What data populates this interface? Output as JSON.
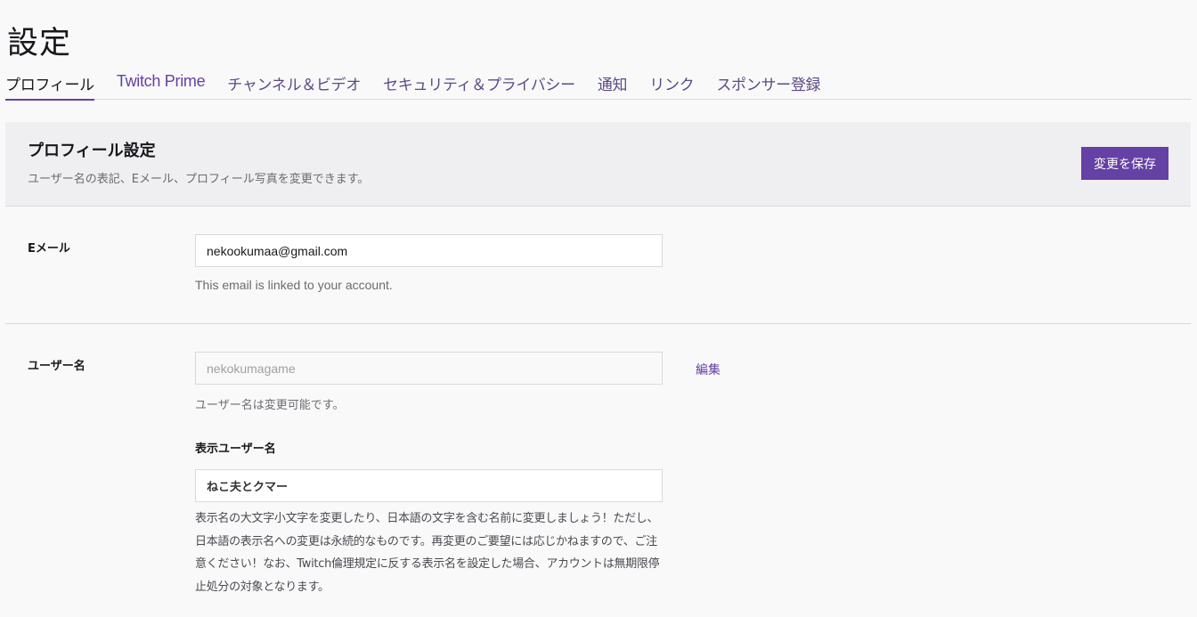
{
  "page": {
    "title": "設定"
  },
  "tabs": [
    {
      "label": "プロフィール",
      "active": true
    },
    {
      "label": "Twitch Prime",
      "active": false
    },
    {
      "label": "チャンネル＆ビデオ",
      "active": false
    },
    {
      "label": "セキュリティ＆プライバシー",
      "active": false
    },
    {
      "label": "通知",
      "active": false
    },
    {
      "label": "リンク",
      "active": false
    },
    {
      "label": "スポンサー登録",
      "active": false
    }
  ],
  "profile_header": {
    "title": "プロフィール設定",
    "subtitle": "ユーザー名の表記、Eメール、プロフィール写真を変更できます。",
    "save_label": "変更を保存"
  },
  "email": {
    "label": "Eメール",
    "value": "nekookumaa@gmail.com",
    "hint": "This email is linked to your account."
  },
  "username": {
    "label": "ユーザー名",
    "placeholder": "nekokumagame",
    "hint": "ユーザー名は変更可能です。",
    "edit_label": "編集"
  },
  "display_name": {
    "label": "表示ユーザー名",
    "value": "ねこ夫とクマー",
    "description": "表示名の大文字小文字を変更したり、日本語の文字を含む名前に変更しましょう！ただし、日本語の表示名への変更は永続的なものです。再変更のご要望には応じかねますので、ご注意ください！なお、Twitch倫理規定に反する表示名を設定した場合、アカウントは無期限停止処分の対象となります。"
  },
  "colors": {
    "accent": "#6441a4",
    "background": "#f9f9fa",
    "panel": "#efeef1",
    "border": "#dad8de"
  }
}
